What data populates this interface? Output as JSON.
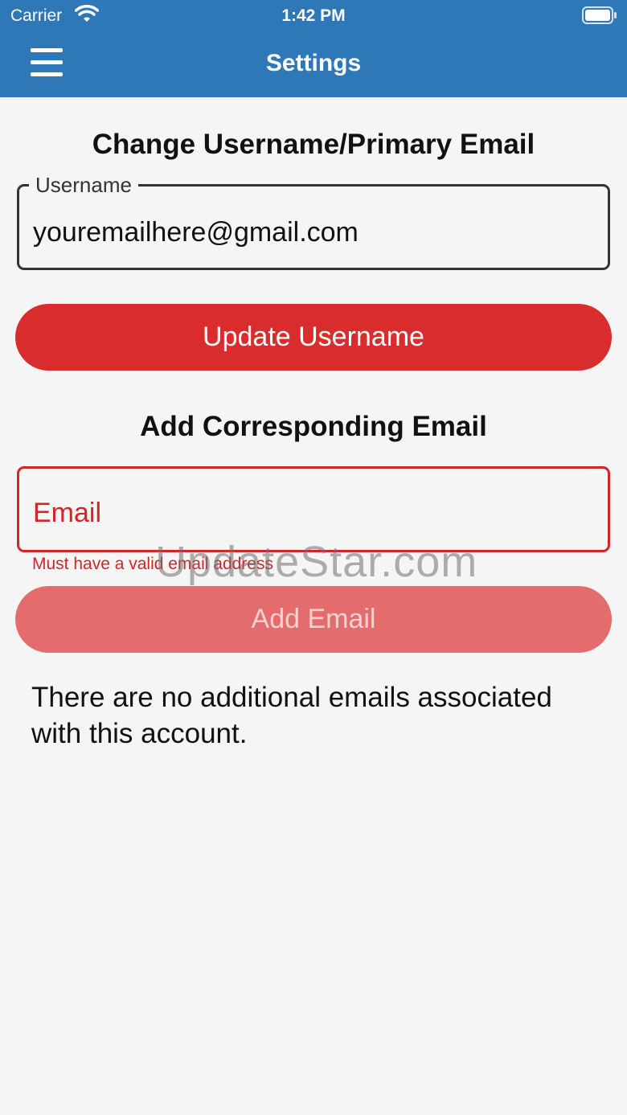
{
  "status_bar": {
    "carrier": "Carrier",
    "time": "1:42 PM"
  },
  "header": {
    "title": "Settings"
  },
  "change_username": {
    "section_title": "Change Username/Primary Email",
    "field_label": "Username",
    "field_value": "youremailhere@gmail.com",
    "button_label": "Update Username"
  },
  "add_email": {
    "section_title": "Add Corresponding Email",
    "placeholder": "Email",
    "error_text": "Must have a valid email address",
    "button_label": "Add Email"
  },
  "info_text": "There are no additional emails associated with this account.",
  "watermark": "UpdateStar.com",
  "colors": {
    "header_bg": "#2f78b8",
    "primary_button": "#d92c2d",
    "disabled_button": "#e46c6c",
    "error": "#d0252b"
  },
  "icons": [
    "wifi-icon",
    "battery-icon",
    "menu-icon"
  ]
}
